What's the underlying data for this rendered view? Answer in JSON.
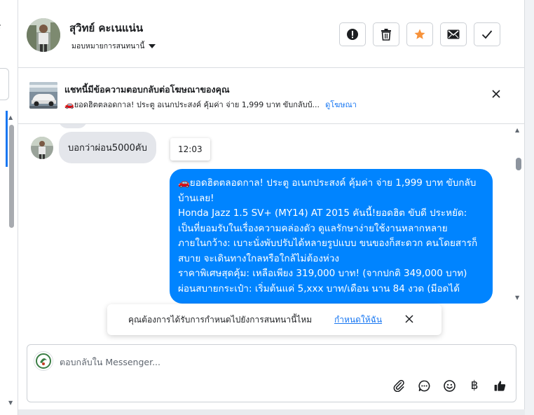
{
  "left_sidebar": {
    "partial_text": "ร"
  },
  "header": {
    "user_name": "สุวิทย์ คะเนแน่น",
    "assign_label": "มอบหมายการสนทนานี้",
    "colors": {
      "star": "#f7923a",
      "border": "#ccd0d5"
    },
    "actions": [
      {
        "icon": "alert-icon"
      },
      {
        "icon": "trash-icon"
      },
      {
        "icon": "star-icon"
      },
      {
        "icon": "mail-icon"
      },
      {
        "icon": "check-icon"
      }
    ]
  },
  "ad_banner": {
    "title": "แชทนี้มีข้อความตอบกลับต่อโฆษณาของคุณ",
    "snippet": "🚗ยอดฮิตตลอดกาล! ประตู อเนกประสงค์ คุ้มค่า จ่าย 1,999 บาท ขับกลับบ้...",
    "link": "ดูโฆษณา"
  },
  "conversation": {
    "incoming_message": "บอกว่าผ่อน5000คับ",
    "timestamp": "12:03",
    "outgoing_lines": [
      "🚗ยอดฮิตตลอดกาล! ประตู อเนกประสงค์ คุ้มค่า จ่าย 1,999 บาท ขับกลับบ้านเลย!",
      "Honda Jazz 1.5 SV+ (MY14) AT 2015 คันนี้!ยอดฮิต ขับดี ประหยัด: เป็นที่ยอมรับในเรื่องความคล่องตัว ดูแลรักษาง่ายใช้งานหลากหลาย",
      "ภายในกว้าง: เบาะนั่งพับปรับได้หลายรูปแบบ ขนของก็สะดวก คนโดยสารก็สบาย จะเดินทางใกลหรือใกล้ไม่ต้องห่วง",
      "ราคาพิเศษสุดคุ้ม: เหลือเพียง 319,000 บาท! (จากปกติ 349,000 บาท)",
      "ผ่อนสบายกระเป๋า: เริ่มต้นแค่ 5,xxx บาท/เดือน นาน 84 งวด (มีอดได้"
    ],
    "outgoing_color": "#0084ff"
  },
  "toast": {
    "text": "คุณต้องการได้รับการกำหนดไปยังการสนทนานี้ไหม",
    "link": "กำหนดให้ฉัน"
  },
  "composer": {
    "placeholder": "ตอบกลับใน Messenger...",
    "value": "",
    "icons": [
      "attachment-icon",
      "saved-replies-icon",
      "emoji-icon",
      "baht-icon",
      "like-icon"
    ],
    "baht_symbol": "฿"
  }
}
